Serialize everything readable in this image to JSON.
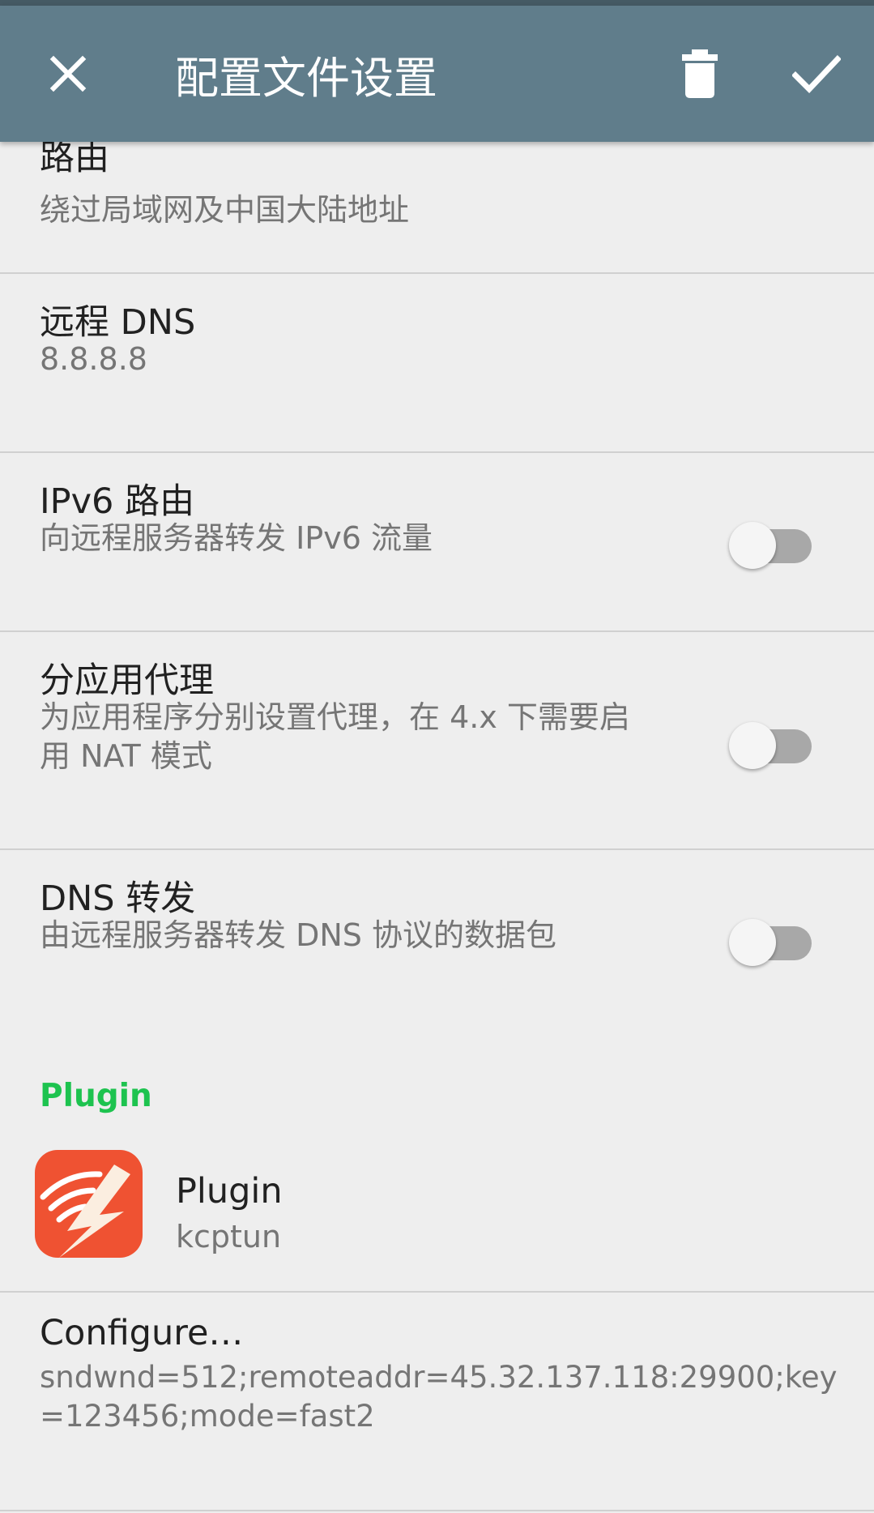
{
  "toolbar": {
    "title": "配置文件设置",
    "close_icon": "close-icon",
    "delete_icon": "trash-icon",
    "confirm_icon": "check-icon",
    "color": "#607d8b"
  },
  "prefs": {
    "route": {
      "title": "路由",
      "summary": "绕过局域网及中国大陆地址"
    },
    "remote_dns": {
      "title": "远程 DNS",
      "summary": "8.8.8.8"
    },
    "ipv6": {
      "title": "IPv6 路由",
      "summary": "向远程服务器转发 IPv6 流量",
      "enabled": false
    },
    "per_app": {
      "title": "分应用代理",
      "summary_line1": "为应用程序分别设置代理，在 4.x 下需要启",
      "summary_line2": "用 NAT 模式",
      "enabled": false
    },
    "dns_forward": {
      "title": "DNS 转发",
      "summary": "由远程服务器转发 DNS 协议的数据包",
      "enabled": false
    }
  },
  "plugin_section": {
    "category": "Plugin",
    "category_color": "#1dc34f",
    "plugin": {
      "title": "Plugin",
      "summary": "kcptun",
      "icon": "kcptun-logo"
    },
    "configure": {
      "title": "Configure…",
      "summary_line1": "sndwnd=512;remoteaddr=45.32.137.118:29900;key",
      "summary_line2": "=123456;mode=fast2"
    }
  }
}
